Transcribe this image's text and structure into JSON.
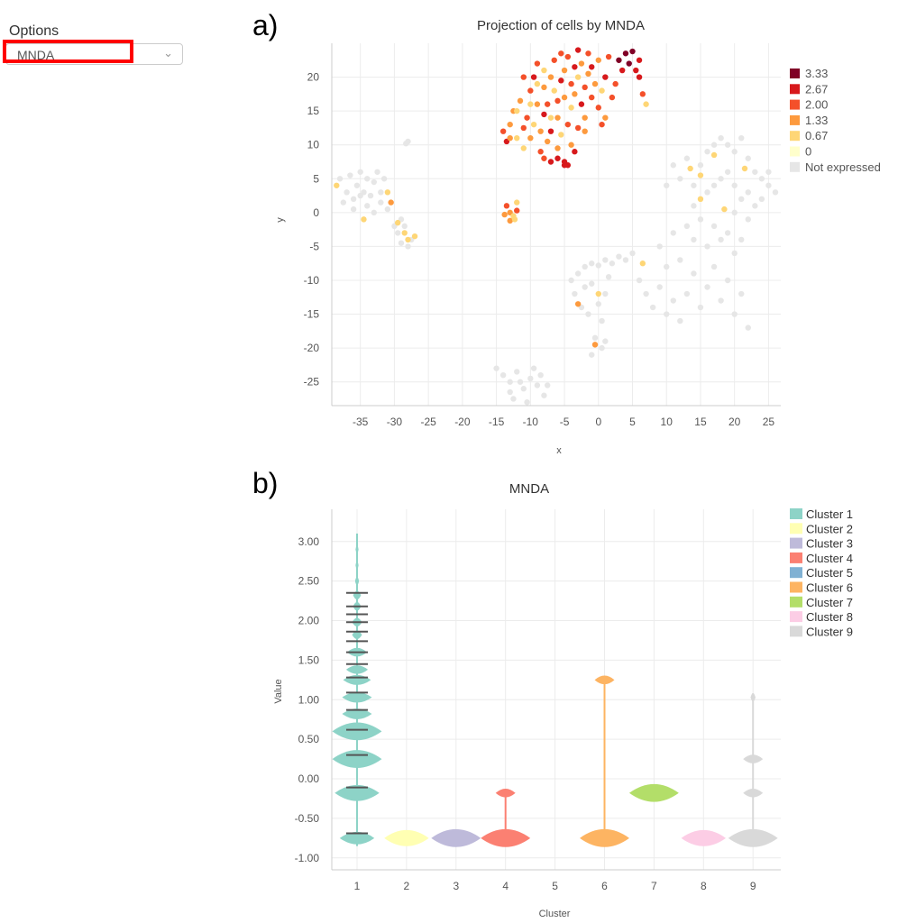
{
  "options": {
    "label": "Options",
    "selected": "MNDA"
  },
  "panels": {
    "a": "a)",
    "b": "b)"
  },
  "chart_data": [
    {
      "type": "scatter",
      "title": "Projection of cells by MNDA",
      "xlabel": "x",
      "ylabel": "y",
      "xlim": [
        -39.2,
        26.8
      ],
      "ylim": [
        -28.5,
        25
      ],
      "xticks": [
        -35,
        -30,
        -25,
        -20,
        -15,
        -10,
        -5,
        0,
        5,
        10,
        15,
        20,
        25
      ],
      "yticks": [
        20,
        15,
        10,
        5,
        0,
        -5,
        -10,
        -15,
        -20,
        -25
      ],
      "grid": true,
      "legend_position": "right",
      "legend": [
        {
          "label": "3.33",
          "color": "#800026"
        },
        {
          "label": "2.67",
          "color": "#d7191c"
        },
        {
          "label": "2.00",
          "color": "#f4502a"
        },
        {
          "label": "1.33",
          "color": "#fd9a3e"
        },
        {
          "label": "0.67",
          "color": "#fed676"
        },
        {
          "label": "0",
          "color": "#ffffcc"
        },
        {
          "label": "Not expressed",
          "color": "#e6e6e6"
        }
      ],
      "expressed_points": [
        [
          -14,
          12,
          2
        ],
        [
          -13.5,
          10.5,
          2.67
        ],
        [
          -13,
          13,
          1.33
        ],
        [
          -12.5,
          15,
          1.33
        ],
        [
          -12,
          11,
          0.67
        ],
        [
          -11.5,
          16.5,
          1.33
        ],
        [
          -11,
          12.5,
          2
        ],
        [
          -11,
          9.5,
          0.67
        ],
        [
          -10.5,
          14,
          2
        ],
        [
          -10,
          18,
          2
        ],
        [
          -10,
          11,
          1.33
        ],
        [
          -9.5,
          20,
          2.67
        ],
        [
          -9.5,
          13,
          0.67
        ],
        [
          -9,
          16,
          1.33
        ],
        [
          -9,
          22,
          2
        ],
        [
          -8.5,
          9,
          2
        ],
        [
          -8.5,
          12,
          1.33
        ],
        [
          -8,
          18.5,
          1.33
        ],
        [
          -8,
          14.5,
          2.67
        ],
        [
          -8,
          21,
          0.67
        ],
        [
          -7.5,
          10.5,
          1.33
        ],
        [
          -7.5,
          16,
          2
        ],
        [
          -7,
          20,
          1.33
        ],
        [
          -7,
          12,
          2.67
        ],
        [
          -7,
          7.5,
          2.67
        ],
        [
          -6.5,
          18,
          0.67
        ],
        [
          -6.5,
          22.5,
          2
        ],
        [
          -6,
          14,
          1.33
        ],
        [
          -6,
          16.5,
          2
        ],
        [
          -6,
          9.5,
          1.33
        ],
        [
          -5.5,
          19.5,
          2.67
        ],
        [
          -5.5,
          11.5,
          0.67
        ],
        [
          -5,
          21,
          1.33
        ],
        [
          -5,
          17,
          1.33
        ],
        [
          -5,
          7,
          2.67
        ],
        [
          -4.5,
          13,
          2
        ],
        [
          -4.5,
          23,
          2
        ],
        [
          -4,
          19,
          2
        ],
        [
          -4,
          15.5,
          0.67
        ],
        [
          -4,
          10,
          1.33
        ],
        [
          -3.5,
          21.5,
          2.67
        ],
        [
          -3.5,
          17.5,
          1.33
        ],
        [
          -3,
          24,
          2.67
        ],
        [
          -3,
          12.5,
          2
        ],
        [
          -3,
          20,
          0.67
        ],
        [
          -2.5,
          16,
          2.67
        ],
        [
          -2.5,
          22,
          1.33
        ],
        [
          -2,
          18.5,
          2
        ],
        [
          -2,
          14,
          1.33
        ],
        [
          -1.5,
          23.5,
          2
        ],
        [
          -1.5,
          20.5,
          1.33
        ],
        [
          -1,
          17,
          2
        ],
        [
          -1,
          21.5,
          2.67
        ],
        [
          -0.5,
          19,
          1.33
        ],
        [
          0,
          15.5,
          2
        ],
        [
          0,
          22.5,
          1.33
        ],
        [
          0.5,
          18,
          0.67
        ],
        [
          1,
          20,
          2.67
        ],
        [
          1,
          14,
          1.33
        ],
        [
          1.5,
          23,
          2
        ],
        [
          2,
          17,
          2
        ],
        [
          3,
          22.5,
          3.33
        ],
        [
          4,
          23.5,
          3.33
        ],
        [
          4.5,
          22,
          3.33
        ],
        [
          5,
          23.8,
          3.33
        ],
        [
          5.5,
          21,
          2.67
        ],
        [
          6,
          22.5,
          2.67
        ],
        [
          6,
          20,
          2.67
        ],
        [
          3.5,
          21,
          2.67
        ],
        [
          6.5,
          17.5,
          2
        ],
        [
          7,
          16,
          0.67
        ],
        [
          -6,
          8,
          2.67
        ],
        [
          -5,
          7.5,
          2.67
        ],
        [
          -4.5,
          7,
          2.67
        ],
        [
          -8,
          8,
          2
        ],
        [
          -12,
          15,
          0.67
        ],
        [
          -13,
          11,
          1.33
        ],
        [
          -10,
          16,
          0.67
        ],
        [
          -7,
          14,
          0.67
        ],
        [
          -2,
          12,
          1.33
        ],
        [
          2.5,
          19,
          2
        ],
        [
          0.5,
          13,
          2
        ],
        [
          -3.5,
          9,
          2.67
        ],
        [
          -9,
          19,
          0.67
        ],
        [
          -11,
          20,
          2
        ],
        [
          -5.5,
          23.5,
          2
        ],
        [
          -13.5,
          1,
          2
        ],
        [
          -13,
          0,
          1.33
        ],
        [
          -12.5,
          -0.5,
          0.67
        ],
        [
          -13,
          -1.2,
          1.33
        ],
        [
          -12,
          1.5,
          0.67
        ],
        [
          -12,
          0.3,
          2
        ],
        [
          -13.8,
          -0.3,
          1.33
        ],
        [
          -12.3,
          -1,
          0.67
        ],
        [
          -38.5,
          4,
          0.67
        ],
        [
          -31,
          3,
          0.67
        ],
        [
          -30.5,
          1.5,
          1.33
        ],
        [
          -34.5,
          -1,
          0.67
        ],
        [
          -29.5,
          -1.5,
          0.67
        ],
        [
          -28,
          -4,
          0.67
        ],
        [
          -27,
          -3.5,
          0.67
        ],
        [
          -28.5,
          -3,
          0.67
        ],
        [
          6.5,
          -7.5,
          0.67
        ],
        [
          0,
          -12,
          0.67
        ],
        [
          -3,
          -13.5,
          1.33
        ],
        [
          -0.5,
          -19.5,
          1.33
        ],
        [
          13.5,
          6.5,
          0.67
        ],
        [
          15,
          5.5,
          0.67
        ],
        [
          17,
          8.5,
          0.67
        ],
        [
          15,
          2,
          0.67
        ],
        [
          18.5,
          0.5,
          0.67
        ],
        [
          21.5,
          6.5,
          0.67
        ]
      ],
      "not_expressed_points": [
        [
          -38,
          5
        ],
        [
          -37,
          3
        ],
        [
          -36.5,
          5.5
        ],
        [
          -36,
          2
        ],
        [
          -35.5,
          4
        ],
        [
          -35,
          6
        ],
        [
          -34.5,
          3
        ],
        [
          -34,
          1
        ],
        [
          -34,
          5
        ],
        [
          -33.5,
          2.5
        ],
        [
          -33,
          4.5
        ],
        [
          -33,
          0
        ],
        [
          -32.5,
          6
        ],
        [
          -32,
          3
        ],
        [
          -32,
          1.5
        ],
        [
          -31.5,
          5
        ],
        [
          -31,
          0.5
        ],
        [
          -36,
          0.5
        ],
        [
          -37.5,
          1.5
        ],
        [
          -35,
          2.5
        ],
        [
          -30,
          -2
        ],
        [
          -29.5,
          -3
        ],
        [
          -29,
          -4.5
        ],
        [
          -28.5,
          -2
        ],
        [
          -28,
          -5
        ],
        [
          -27.5,
          -4
        ],
        [
          -29,
          -1
        ],
        [
          -28,
          10.5
        ],
        [
          -28.3,
          10.2
        ],
        [
          -14,
          -24
        ],
        [
          -13,
          -25
        ],
        [
          -12,
          -23.5
        ],
        [
          -11,
          -26
        ],
        [
          -10,
          -24.5
        ],
        [
          -9,
          -25.5
        ],
        [
          -8,
          -27
        ],
        [
          -12.5,
          -27.5
        ],
        [
          -10.5,
          -28
        ],
        [
          -9.5,
          -23
        ],
        [
          -11.5,
          -25
        ],
        [
          -13,
          -26.5
        ],
        [
          -8.5,
          -24
        ],
        [
          -7.5,
          -25.5
        ],
        [
          -15,
          -23
        ],
        [
          -4,
          -10
        ],
        [
          -3.5,
          -12
        ],
        [
          -3,
          -9
        ],
        [
          -2,
          -11
        ],
        [
          -1.5,
          -15
        ],
        [
          -1,
          -10.5
        ],
        [
          0,
          -13.5
        ],
        [
          1,
          -12
        ],
        [
          1.5,
          -9.5
        ],
        [
          -2.5,
          -14
        ],
        [
          0.5,
          -16
        ],
        [
          -0.5,
          -18.5
        ],
        [
          0.5,
          -20
        ],
        [
          1,
          -19
        ],
        [
          -1,
          -21
        ],
        [
          -2,
          -8
        ],
        [
          -1,
          -7.5
        ],
        [
          0,
          -7.8
        ],
        [
          1,
          -7
        ],
        [
          2,
          -7.5
        ],
        [
          3,
          -6.5
        ],
        [
          4,
          -7
        ],
        [
          5,
          -6
        ],
        [
          6,
          -10
        ],
        [
          7,
          -12
        ],
        [
          8,
          -14
        ],
        [
          9,
          -11
        ],
        [
          10,
          -15
        ],
        [
          11,
          -13
        ],
        [
          12,
          -16
        ],
        [
          13,
          -12
        ],
        [
          14,
          -9
        ],
        [
          15,
          -14
        ],
        [
          16,
          -11
        ],
        [
          17,
          -8
        ],
        [
          18,
          -13
        ],
        [
          19,
          -10
        ],
        [
          20,
          -15
        ],
        [
          21,
          -12
        ],
        [
          22,
          -17
        ],
        [
          20,
          -6
        ],
        [
          18,
          -4
        ],
        [
          16,
          -5
        ],
        [
          14,
          -4
        ],
        [
          12,
          -7
        ],
        [
          10,
          -8
        ],
        [
          9,
          -5
        ],
        [
          11,
          -3
        ],
        [
          13,
          -2
        ],
        [
          15,
          -1
        ],
        [
          17,
          -2
        ],
        [
          19,
          -3
        ],
        [
          21,
          -4
        ],
        [
          14,
          1
        ],
        [
          14,
          4
        ],
        [
          15,
          7
        ],
        [
          16,
          9
        ],
        [
          17,
          10
        ],
        [
          18,
          11
        ],
        [
          19,
          10
        ],
        [
          20,
          9
        ],
        [
          21,
          11
        ],
        [
          22,
          8
        ],
        [
          23,
          6
        ],
        [
          24,
          5
        ],
        [
          25,
          4
        ],
        [
          26,
          3
        ],
        [
          25,
          6
        ],
        [
          24,
          2
        ],
        [
          23,
          1
        ],
        [
          22,
          3
        ],
        [
          21,
          2
        ],
        [
          20,
          4
        ],
        [
          19,
          6
        ],
        [
          18,
          5
        ],
        [
          17,
          4
        ],
        [
          16,
          3
        ],
        [
          13,
          8
        ],
        [
          12,
          5
        ],
        [
          11,
          7
        ],
        [
          10,
          4
        ],
        [
          22,
          -1
        ],
        [
          20,
          0
        ]
      ]
    },
    {
      "type": "violin",
      "title": "MNDA",
      "xlabel": "Cluster",
      "ylabel": "Value",
      "categories": [
        "1",
        "2",
        "3",
        "4",
        "5",
        "6",
        "7",
        "8",
        "9"
      ],
      "ylim": [
        -1.15,
        3.4
      ],
      "yticks": [
        "3.00",
        "2.50",
        "2.00",
        "1.50",
        "1.00",
        "0.50",
        "0.00",
        "-0.50",
        "-1.00"
      ],
      "grid": true,
      "legend_position": "right",
      "series": [
        {
          "name": "Cluster 1",
          "color": "#8dd3c7",
          "modes": [
            [
              -0.75,
              0.35
            ],
            [
              -0.18,
              0.45
            ],
            [
              0.25,
              0.5
            ],
            [
              0.6,
              0.5
            ],
            [
              0.82,
              0.3
            ],
            [
              1.03,
              0.3
            ],
            [
              1.25,
              0.28
            ],
            [
              1.38,
              0.22
            ],
            [
              1.6,
              0.2
            ],
            [
              1.82,
              0.1
            ],
            [
              1.98,
              0.1
            ],
            [
              2.18,
              0.08
            ],
            [
              2.32,
              0.08
            ],
            [
              2.5,
              0.04
            ],
            [
              2.7,
              0.03
            ],
            [
              2.9,
              0.03
            ],
            [
              3.05,
              0.02
            ]
          ],
          "box_marks": [
            -0.69,
            -0.11,
            0.3,
            0.62,
            0.87,
            1.09,
            1.28,
            1.45,
            1.6,
            1.74,
            1.86,
            1.98,
            2.08,
            2.18,
            2.35
          ]
        },
        {
          "name": "Cluster 2",
          "color": "#ffffb3",
          "modes": [
            [
              -0.75,
              0.45
            ]
          ],
          "box_marks": []
        },
        {
          "name": "Cluster 3",
          "color": "#bebada",
          "modes": [
            [
              -0.75,
              0.5
            ]
          ],
          "box_marks": []
        },
        {
          "name": "Cluster 4",
          "color": "#fb8072",
          "modes": [
            [
              -0.75,
              0.5
            ],
            [
              -0.18,
              0.2
            ]
          ],
          "box_marks": []
        },
        {
          "name": "Cluster 5",
          "color": "#80b1d3",
          "modes": [],
          "box_marks": []
        },
        {
          "name": "Cluster 6",
          "color": "#fdb462",
          "modes": [
            [
              -0.75,
              0.5
            ],
            [
              1.25,
              0.2
            ]
          ],
          "box_marks": []
        },
        {
          "name": "Cluster 7",
          "color": "#b3de69",
          "modes": [
            [
              -0.18,
              0.5
            ]
          ],
          "box_marks": []
        },
        {
          "name": "Cluster 8",
          "color": "#fccde5",
          "modes": [
            [
              -0.75,
              0.45
            ]
          ],
          "box_marks": []
        },
        {
          "name": "Cluster 9",
          "color": "#d9d9d9",
          "modes": [
            [
              -0.75,
              0.5
            ],
            [
              -0.18,
              0.2
            ],
            [
              0.25,
              0.2
            ],
            [
              1.03,
              0.05
            ]
          ],
          "box_marks": []
        }
      ]
    }
  ]
}
